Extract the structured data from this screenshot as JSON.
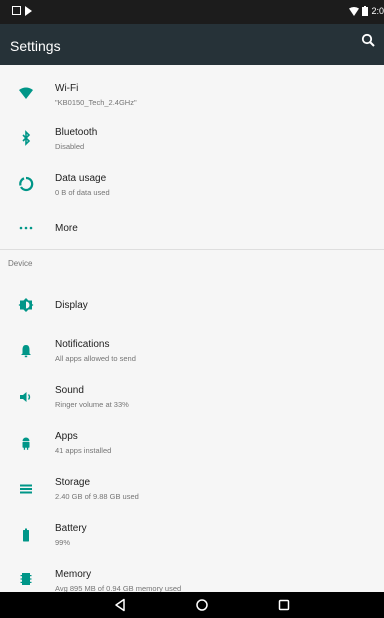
{
  "status_bar": {
    "time": "2:0",
    "icons": [
      "notification-image-icon",
      "notification-play-icon",
      "wifi-icon",
      "battery-icon"
    ]
  },
  "app_bar": {
    "title": "Settings",
    "search_icon": "search-icon"
  },
  "wireless_items": [
    {
      "key": "wifi",
      "icon": "wifi-icon",
      "title": "Wi-Fi",
      "subtitle": "\"KB0150_Tech_2.4GHz\""
    },
    {
      "key": "bluetooth",
      "icon": "bluetooth-icon",
      "title": "Bluetooth",
      "subtitle": "Disabled"
    },
    {
      "key": "data-usage",
      "icon": "data-usage-icon",
      "title": "Data usage",
      "subtitle": "0 B of data used"
    },
    {
      "key": "more",
      "icon": "more-icon",
      "title": "More",
      "subtitle": ""
    }
  ],
  "device_section": {
    "header": "Device",
    "items": [
      {
        "key": "display",
        "icon": "display-brightness-icon",
        "title": "Display",
        "subtitle": ""
      },
      {
        "key": "notifications",
        "icon": "notifications-bell-icon",
        "title": "Notifications",
        "subtitle": "All apps allowed to send"
      },
      {
        "key": "sound",
        "icon": "sound-speaker-icon",
        "title": "Sound",
        "subtitle": "Ringer volume at 33%"
      },
      {
        "key": "apps",
        "icon": "apps-android-icon",
        "title": "Apps",
        "subtitle": "41 apps installed"
      },
      {
        "key": "storage",
        "icon": "storage-icon",
        "title": "Storage",
        "subtitle": "2.40 GB of 9.88 GB used"
      },
      {
        "key": "battery",
        "icon": "battery-icon",
        "title": "Battery",
        "subtitle": "99%"
      },
      {
        "key": "memory",
        "icon": "memory-chip-icon",
        "title": "Memory",
        "subtitle": "Avg 895 MB of 0.94 GB memory used"
      }
    ]
  },
  "nav_bar": {
    "icons": [
      "back-icon",
      "home-icon",
      "recents-icon"
    ]
  },
  "colors": {
    "accent": "#009688",
    "app_bar": "#263238",
    "status_bar": "#1c1c1c",
    "background": "#f6f6f6"
  }
}
